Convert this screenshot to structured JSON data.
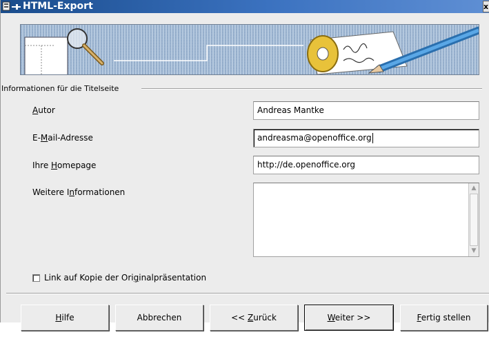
{
  "window": {
    "title": "HTML-Export",
    "close_glyph": "x"
  },
  "group": {
    "label": "Informationen für die Titelseite"
  },
  "fields": {
    "author": {
      "label": "Autor",
      "value": "Andreas Mantke"
    },
    "email": {
      "label": "E-Mail-Adresse",
      "value": "andreasma@openoffice.org"
    },
    "homepage": {
      "label": "Ihre Homepage",
      "value": "http://de.openoffice.org"
    },
    "more_info": {
      "label": "Weitere Informationen",
      "value": ""
    }
  },
  "checkbox": {
    "label": "Link auf Kopie der Originalpräsentation",
    "checked": false
  },
  "buttons": {
    "help": "Hilfe",
    "cancel": "Abbrechen",
    "back": "<< Zurück",
    "next": "Weiter >>",
    "finish": "Fertig stellen"
  },
  "colors": {
    "titlebar": "#1a4c8c",
    "dialog_bg": "#ececec",
    "banner_bg": "#9fb7d2"
  },
  "icons": [
    "window-menu-icon",
    "pin-icon",
    "magnifier-page-illustration",
    "signed-tag-pencil-illustration",
    "scroll-up-icon",
    "scroll-down-icon"
  ]
}
